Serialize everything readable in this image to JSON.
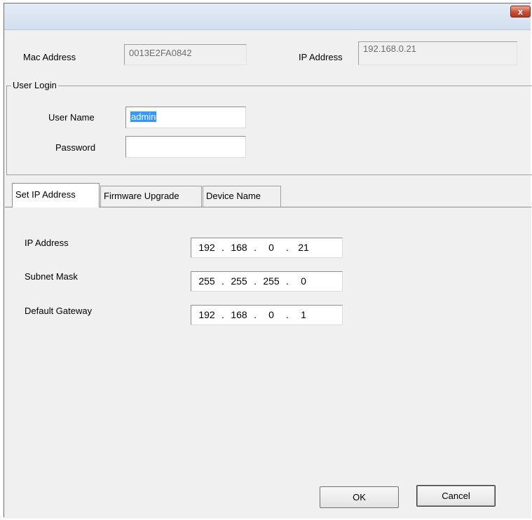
{
  "window": {
    "title": "",
    "close_glyph": "x"
  },
  "device_info": {
    "mac_label": "Mac Address",
    "mac_value": "0013E2FA0842",
    "ip_label": "IP Address",
    "ip_value": "192.168.0.21"
  },
  "user_login": {
    "group_title": "User Login",
    "username_label": "User Name",
    "username_value": "admin",
    "password_label": "Password",
    "password_value": ""
  },
  "tabs": [
    {
      "label": "Set IP Address",
      "active": true
    },
    {
      "label": "Firmware Upgrade",
      "active": false
    },
    {
      "label": "Device Name",
      "active": false
    }
  ],
  "ip_settings": {
    "ip_address": {
      "label": "IP Address",
      "octets": [
        "192",
        "168",
        "0",
        "21"
      ]
    },
    "subnet_mask": {
      "label": "Subnet Mask",
      "octets": [
        "255",
        "255",
        "255",
        "0"
      ]
    },
    "default_gateway": {
      "label": "Default Gateway",
      "octets": [
        "192",
        "168",
        "0",
        "1"
      ]
    },
    "separator": "."
  },
  "buttons": {
    "ok": "OK",
    "cancel": "Cancel"
  }
}
